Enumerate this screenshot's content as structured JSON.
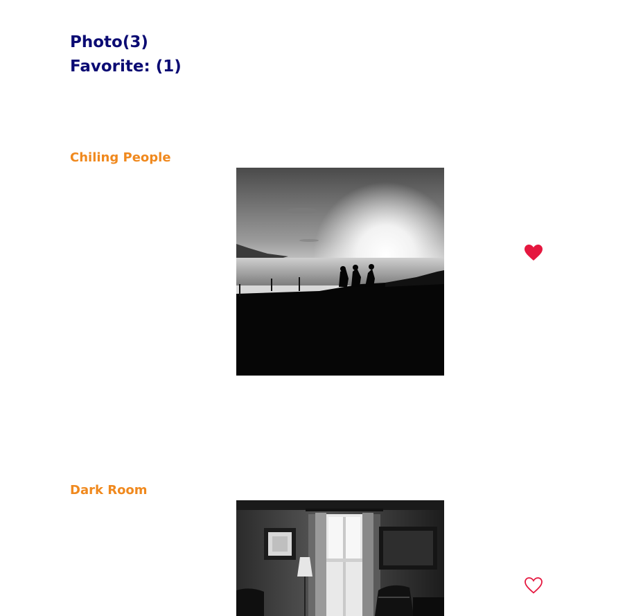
{
  "header": {
    "photo_count_label": "Photo(3)",
    "favorite_count_label": "Favorite: (1)"
  },
  "photos": [
    {
      "title": "Chiling People",
      "favorited": true,
      "heart_icon": "heart-filled-icon",
      "heart_color": "#e5173f"
    },
    {
      "title": "Dark Room",
      "favorited": false,
      "heart_icon": "heart-outline-icon",
      "heart_color": "#e5173f"
    }
  ],
  "colors": {
    "header_text": "#0b0b73",
    "photo_title": "#f0891e"
  }
}
